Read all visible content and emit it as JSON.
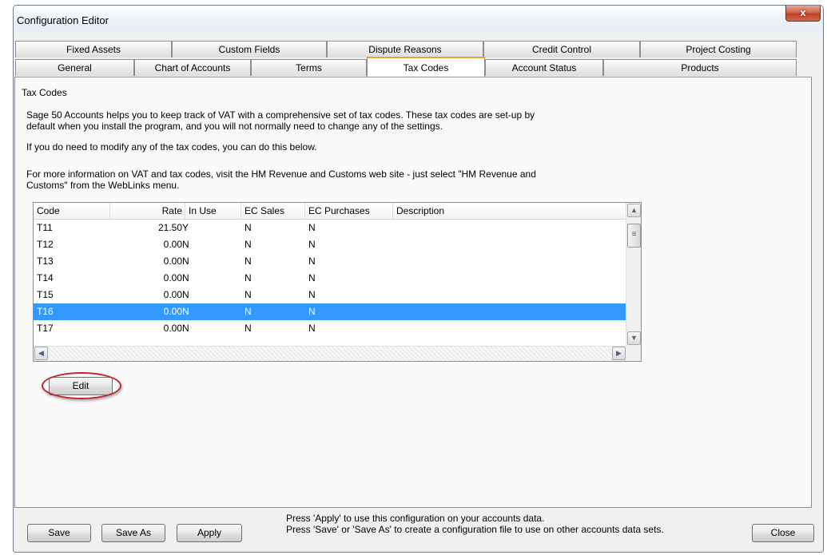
{
  "window": {
    "title": "Configuration Editor",
    "close_glyph": "x"
  },
  "tabs_back": [
    "Fixed Assets",
    "Custom Fields",
    "Dispute Reasons",
    "Credit Control",
    "Project Costing"
  ],
  "tabs_front": [
    "General",
    "Chart of Accounts",
    "Terms",
    "Tax Codes",
    "Account Status",
    "Products"
  ],
  "selected_tab": "Tax Codes",
  "panel": {
    "title": "Tax Codes",
    "paragraph1": "Sage 50 Accounts helps you to keep track of VAT with a comprehensive set of tax codes. These tax codes are set-up by\ndefault when you install the program, and you will not normally need to change any of the settings.",
    "paragraph2": "If you do need to modify any of the tax codes, you can do this below.",
    "paragraph3": "For more information on VAT and tax codes, visit the HM Revenue and Customs web site - just select \"HM Revenue and\nCustoms\" from the WebLinks menu."
  },
  "table": {
    "columns": [
      "Code",
      "Rate",
      "In Use",
      "EC Sales",
      "EC Purchases",
      "Description"
    ],
    "rows": [
      [
        "T11",
        "21.50",
        "Y",
        "N",
        "N",
        ""
      ],
      [
        "T12",
        "0.00",
        "N",
        "N",
        "N",
        ""
      ],
      [
        "T13",
        "0.00",
        "N",
        "N",
        "N",
        ""
      ],
      [
        "T14",
        "0.00",
        "N",
        "N",
        "N",
        ""
      ],
      [
        "T15",
        "0.00",
        "N",
        "N",
        "N",
        ""
      ],
      [
        "T16",
        "0.00",
        "N",
        "N",
        "N",
        ""
      ],
      [
        "T17",
        "0.00",
        "N",
        "N",
        "N",
        ""
      ]
    ],
    "selected_row": 5
  },
  "buttons": {
    "edit": "Edit",
    "save": "Save",
    "save_as": "Save As",
    "apply": "Apply",
    "close": "Close"
  },
  "footer": {
    "line1": "Press 'Apply' to use this configuration on your accounts data.",
    "line2": "Press 'Save' or 'Save As' to create a configuration file to use on other accounts data sets."
  },
  "colors": {
    "selection": "#3399ff",
    "tab_accent": "#e8a33b",
    "highlight_ring": "#c0272d"
  }
}
